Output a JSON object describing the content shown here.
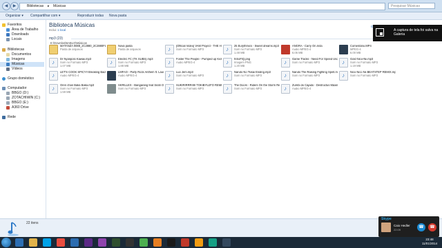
{
  "address": {
    "crumbs": [
      "Bibliotecas",
      "Músicas"
    ],
    "search_placeholder": "Pesquisar Músicas"
  },
  "toolbar": {
    "organize": "Organizar ▾",
    "share": "Compartilhar com ▾",
    "play_all": "Reproduzir todas",
    "new_folder": "Nova pasta"
  },
  "nav": {
    "favorites": "Favoritos",
    "desktop": "Área de Trabalho",
    "downloads": "Downloads",
    "recent": "Locais",
    "libraries": "Bibliotecas",
    "documents": "Documentos",
    "images": "Imagens",
    "music": "Músicas",
    "videos": "Vídeos",
    "homegroup": "Grupo doméstico",
    "computer": "Computador",
    "drive_d": "BBGO (D:)",
    "drive_c": "ZOTACHIWIN (C:)",
    "drive_e": "BBGO (E:)",
    "drive_a": "A360 Drive",
    "network": "Rede"
  },
  "library": {
    "title": "Biblioteca Músicas",
    "includes_label": "Inclui:",
    "includes_value": "1 local",
    "arrange": "Organizar por: Pasta ▾"
  },
  "group": {
    "name": "mp3 (23)",
    "path": "E:\\Downlos\\BABLO\\Músicas"
  },
  "files": [
    {
      "name": "MATANZA 0088_2C2880_2C2880FLAC_2",
      "type": "Pasta de arquivos",
      "size": "",
      "thumb": "folder"
    },
    {
      "name": "Nova pasta",
      "type": "Pasta de arquivos",
      "size": "",
      "thumb": "folder"
    },
    {
      "name": "[Official Video] VAM Project - THE HEROS (Kamen Kobushin Hiero T...",
      "type": "Som no Formato MP3",
      "size": "",
      "thumb": "doc"
    },
    {
      "name": "25 Eurythmics - Sweet dreams.mp3",
      "type": "Som no Formato MP3",
      "size": "1.48 MB",
      "thumb": "doc"
    },
    {
      "name": "ANGRA - Carry On.m4a",
      "type": "Áudio MPEG-4",
      "size": "6.05 MB",
      "thumb": "art"
    },
    {
      "name": "Comentário.MP4",
      "type": "MPEG-4",
      "size": "6.00 MB",
      "thumb": "art"
    },
    {
      "name": "Dr Nyanpolo Kawaii.mp3",
      "type": "Som no Formato MP3",
      "size": "1.07 MB",
      "thumb": "doc"
    },
    {
      "name": "Electric FC (TK SUBS).mp3",
      "type": "Som no Formato MP3",
      "size": "1.88 MB",
      "thumb": "doc"
    },
    {
      "name": "Foster The People - Pumped up Kicks.m4a",
      "type": "Áudio MPEG-4",
      "size": "",
      "thumb": "doc"
    },
    {
      "name": "fnSoFIQ.png",
      "type": "Imagem PNG",
      "size": "1.20 MB",
      "thumb": "doc"
    },
    {
      "name": "Game Tracks - Need For Speed Underground Get Low.mp3",
      "type": "Som no Formato MP3",
      "size": "",
      "thumb": "doc"
    },
    {
      "name": "Gold Nico-Nii.mp3",
      "type": "Som no Formato MP3",
      "size": "1.19 MB",
      "thumb": "doc"
    },
    {
      "name": "LET'S COOK SPICY!! Breaking Bad Parody _ Rebrep Spawn - Work Bit...",
      "type": "Áudio MPEG-4",
      "size": "",
      "thumb": "doc"
    },
    {
      "name": "LMFAO - Party Rock Anthem ft. Lauren Bennett, GoonRock.m4a",
      "type": "Áudio MPEG-4",
      "size": "",
      "thumb": "art"
    },
    {
      "name": "Luo Jem.mp3",
      "type": "Som no Formato MP3",
      "size": "",
      "thumb": "doc"
    },
    {
      "name": "Naruto No Tsisai Ending.mp3",
      "type": "Som no Formato MP3",
      "size": "",
      "thumb": "doc"
    },
    {
      "name": "Naruto The Raising Fighting Spirit.mp3",
      "type": "Som no Formato MP3",
      "size": "",
      "thumb": "doc"
    },
    {
      "name": "Nico Nico Nii BEATSTEP REMIX.mp3",
      "type": "Som no Formato MP3",
      "size": "",
      "thumb": "doc"
    },
    {
      "name": "Oren chan Baka Baka.mp3",
      "type": "Som no Formato MP3",
      "size": "1.59 MB",
      "thumb": "doc"
    },
    {
      "name": "SKRILLEX - Bangarang feat Sirah Official Music Video.mp3",
      "type": "Som no Formato MP3",
      "size": "",
      "thumb": "art"
    },
    {
      "name": "SUKIRIRRRIIIII TOKIBYUJFO REMIX(GGJ MAD).mp3",
      "type": "Som no Formato MP3",
      "size": "",
      "thumb": "doc"
    },
    {
      "name": "The Doors - Riders On the Storm Remastered HQ.mp3",
      "type": "Som no Formato MP3",
      "size": "",
      "thumb": "doc"
    },
    {
      "name": "Zumbi do Cajado - Destructus Maximus (COMPLETO).m4a",
      "type": "Áudio MPEG-4",
      "size": "",
      "thumb": "doc"
    }
  ],
  "toast": {
    "text": "A captura de tela foi salva na Galeria"
  },
  "details": {
    "count": "22 itens"
  },
  "notification": {
    "app": "Skype",
    "name": "Caio Hedler",
    "status": "22:09"
  },
  "clock": {
    "time": "23:48",
    "date": "11/01/2014"
  },
  "colors": {
    "accent": "#1e395b",
    "link": "#1a64b8",
    "taskbar": "#1b2a38"
  }
}
